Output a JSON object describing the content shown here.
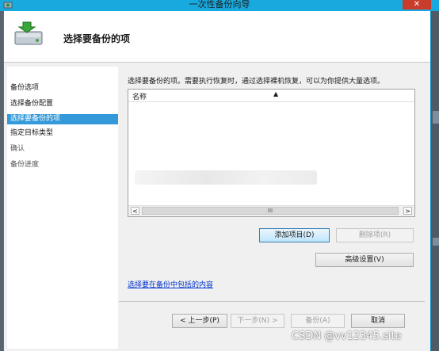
{
  "window": {
    "title": "一次性备份向导",
    "close_glyph": "✕"
  },
  "header": {
    "title": "选择要备份的项"
  },
  "nav": {
    "items": [
      {
        "label": "备份选项"
      },
      {
        "label": "选择备份配置"
      },
      {
        "label": "选择要备份的项"
      },
      {
        "label": "指定目标类型"
      },
      {
        "label": "确认"
      },
      {
        "label": "备份进度"
      }
    ]
  },
  "main": {
    "instruction": "选择要备份的项。需要执行恢复时，通过选择裸机恢复，可以为你提供大量选项。",
    "list": {
      "column_name": "名称",
      "sort_glyph": "▲",
      "scroll_left": "<",
      "scroll_right": ">",
      "scroll_thumb": "III"
    },
    "add_item_label": "添加项目(D)",
    "remove_item_label": "删除项(R)",
    "advanced_label": "高级设置(V)",
    "link_text": "选择要在备份中包括的内容"
  },
  "footer": {
    "prev_label": "< 上一步(P)",
    "next_label": "下一步(N) >",
    "backup_label": "备份(A)",
    "cancel_label": "取消"
  },
  "watermark": "CSDN @vv12345.site"
}
